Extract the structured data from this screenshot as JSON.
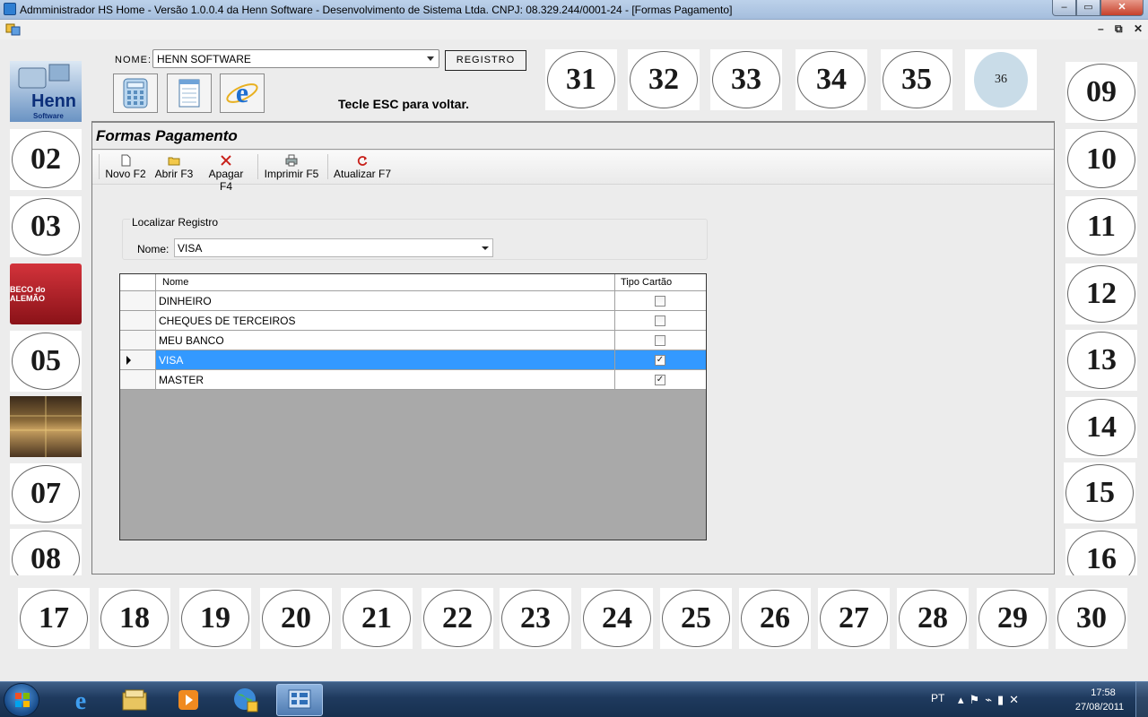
{
  "window": {
    "title": "Admministrador HS Home - Versão 1.0.0.4 da Henn Software - Desenvolvimento de Sistema Ltda. CNPJ: 08.329.244/0001-24 - [Formas Pagamento]",
    "min_glyph": "–",
    "max_glyph": "▭",
    "close_glyph": "✕",
    "mdi_min": "–",
    "mdi_restore": "⧉",
    "mdi_close": "✕"
  },
  "header": {
    "nome_label": "NOME:",
    "nome_value": "HENN SOFTWARE",
    "registro_label": "REGISTRO",
    "esc_text": "Tecle ESC para voltar."
  },
  "tiles": {
    "top": [
      "31",
      "32",
      "33",
      "34",
      "35",
      "36"
    ],
    "left": [
      "02",
      "03",
      "05",
      "07",
      "08"
    ],
    "right": [
      "09",
      "10",
      "11",
      "12",
      "13",
      "14",
      "15",
      "16"
    ],
    "bottom": [
      "17",
      "18",
      "19",
      "20",
      "21",
      "22",
      "23",
      "24",
      "25",
      "26",
      "27",
      "28",
      "29",
      "30"
    ],
    "logos": {
      "henn_line1": "Henn",
      "henn_line2": "Software",
      "beco": "BECO do ALEMÃO"
    }
  },
  "form": {
    "title": "Formas Pagamento",
    "toolbar": {
      "novo": "Novo F2",
      "abrir": "Abrir F3",
      "apagar": "Apagar F4",
      "imprimir": "Imprimir F5",
      "atualizar": "Atualizar F7"
    },
    "search": {
      "group_label": "Localizar Registro",
      "label": "Nome:",
      "value": "VISA"
    },
    "grid": {
      "columns": [
        "Nome",
        "Tipo Cartão"
      ],
      "rows": [
        {
          "nome": "DINHEIRO",
          "tipo_cartao": false,
          "check": ""
        },
        {
          "nome": "CHEQUES DE TERCEIROS",
          "tipo_cartao": false,
          "check": ""
        },
        {
          "nome": "MEU BANCO",
          "tipo_cartao": false,
          "check": ""
        },
        {
          "nome": "VISA",
          "tipo_cartao": true,
          "check": "✓"
        },
        {
          "nome": "MASTER",
          "tipo_cartao": true,
          "check": "✓"
        }
      ]
    }
  },
  "taskbar": {
    "language": "PT",
    "time": "17:58",
    "date": "27/08/2011"
  },
  "colors": {
    "selection": "#3399ff",
    "titlebar": "#bcd1ea"
  }
}
